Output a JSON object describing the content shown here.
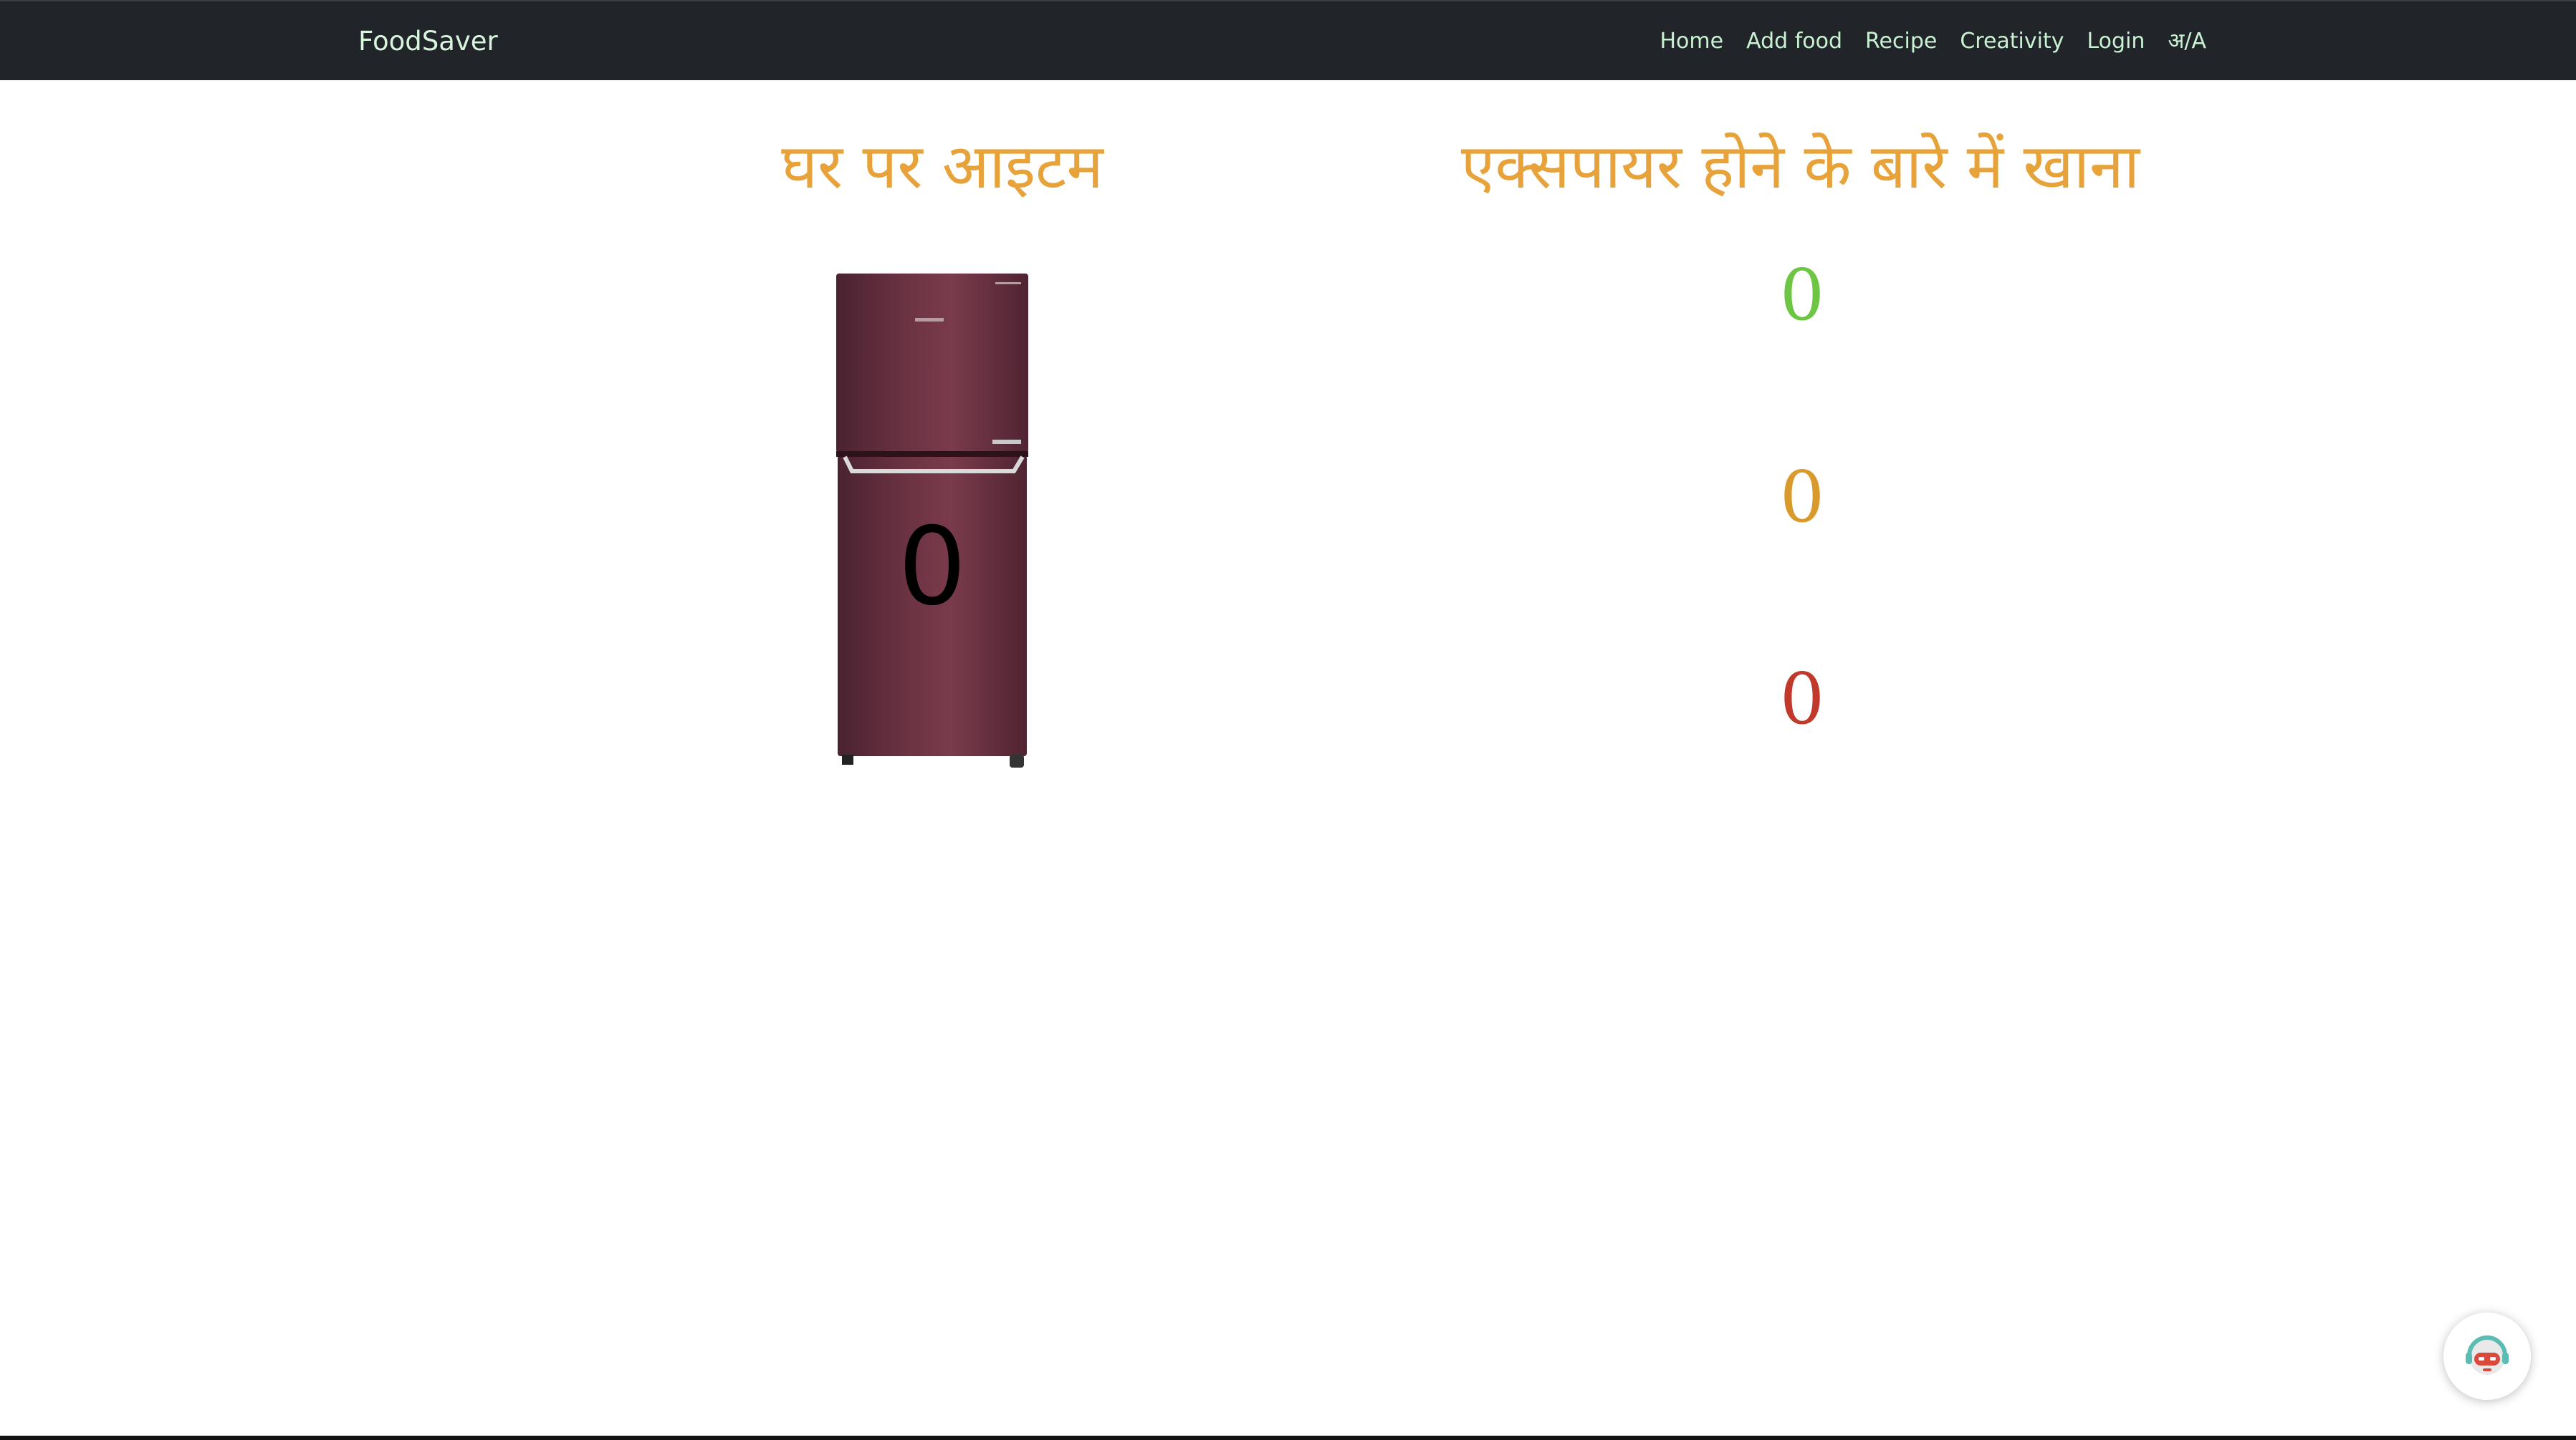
{
  "navbar": {
    "brand": "FoodSaver",
    "links": [
      "Home",
      "Add food",
      "Recipe",
      "Creativity",
      "Login",
      "अ/A"
    ]
  },
  "home_items": {
    "heading": "घर पर आइटम",
    "count": "0",
    "fridge_color": "#5c2a38"
  },
  "expiring": {
    "heading": "एक्सपायर होने के बारे में खाना",
    "counts": [
      {
        "value": "0",
        "color": "#6cc644"
      },
      {
        "value": "0",
        "color": "#d99a2b"
      },
      {
        "value": "0",
        "color": "#c0392b"
      }
    ]
  },
  "colors": {
    "navbar_bg": "#212529",
    "heading": "#e7a23a"
  },
  "chatbot": {
    "icon": "chatbot-robot-icon"
  }
}
